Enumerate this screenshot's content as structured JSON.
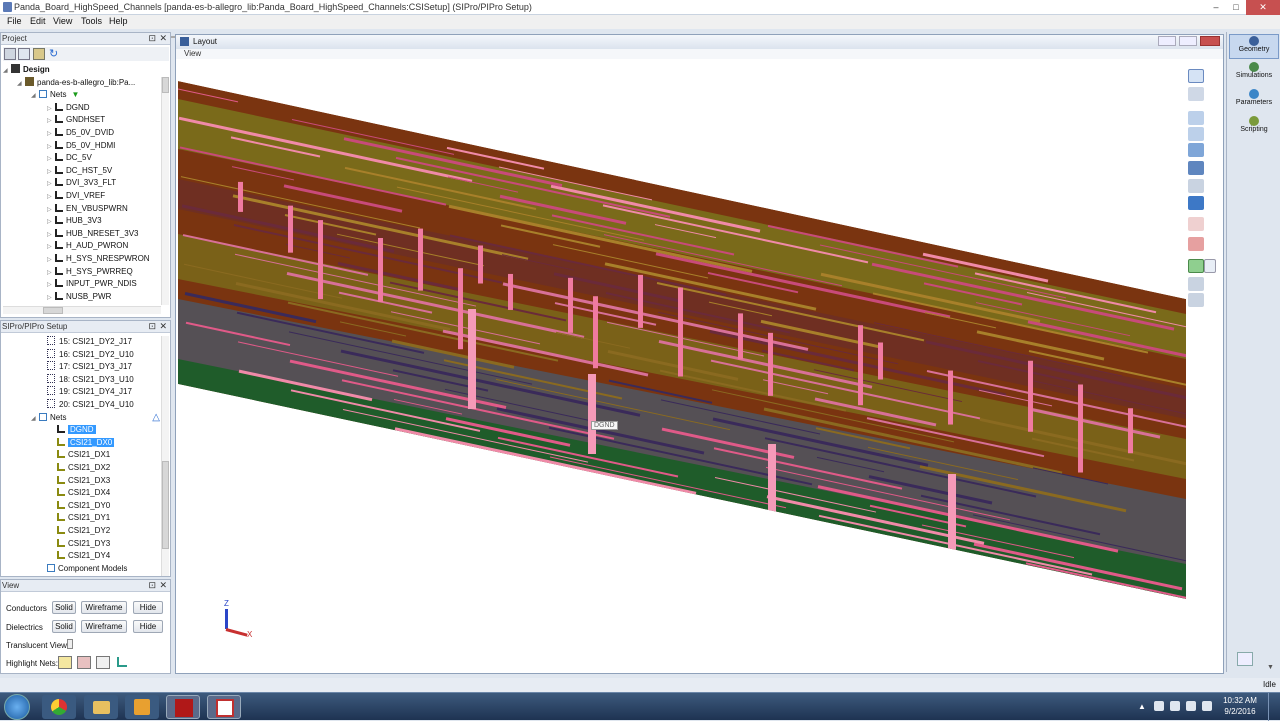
{
  "window": {
    "title": "Panda_Board_HighSpeed_Channels [panda-es-b-allegro_lib:Panda_Board_HighSpeed_Channels:CSISetup] (SIPro/PIPro Setup)"
  },
  "menu": [
    "File",
    "Edit",
    "View",
    "Tools",
    "Help"
  ],
  "zoom_multiplier": "x 1",
  "project_panel": {
    "title": "Project",
    "design_label": "Design",
    "library_label": "panda-es-b-allegro_lib:Pa...",
    "nets_label": "Nets",
    "nets": [
      "DGND",
      "GNDHSET",
      "D5_0V_DVID",
      "D5_0V_HDMI",
      "DC_5V",
      "DC_HST_5V",
      "DVI_3V3_FLT",
      "DVI_VREF",
      "EN_VBUSPWRN",
      "HUB_3V3",
      "HUB_NRESET_3V3",
      "H_AUD_PWRON",
      "H_SYS_NRESPWRON",
      "H_SYS_PWRREQ",
      "INPUT_PWR_NDIS",
      "NUSB_PWR"
    ]
  },
  "setup_panel": {
    "title": "SIPro/PIPro Setup",
    "ports": [
      "15: CSI21_DY2_J17",
      "16: CSI21_DY2_U10",
      "17: CSI21_DY3_J17",
      "18: CSI21_DY3_U10",
      "19: CSI21_DY4_J17",
      "20: CSI21_DY4_U10"
    ],
    "nets_label": "Nets",
    "nets": [
      "DGND",
      "CSI21_DX0",
      "CSI21_DX1",
      "CSI21_DX2",
      "CSI21_DX3",
      "CSI21_DX4",
      "CSI21_DY0",
      "CSI21_DY1",
      "CSI21_DY2",
      "CSI21_DY3",
      "CSI21_DY4"
    ],
    "selected_nets": [
      "DGND",
      "CSI21_DX0"
    ],
    "component_models_label": "Component Models"
  },
  "view_panel": {
    "title": "View",
    "conductors_label": "Conductors",
    "dielectrics_label": "Dielectrics",
    "solid_label": "Solid",
    "wireframe_label": "Wireframe",
    "hide_label": "Hide",
    "translucent_label": "Translucent View:",
    "highlight_label": "Highlight Nets:"
  },
  "layout_window": {
    "title": "Layout",
    "menu_view": "View",
    "tooltip": "DGND",
    "axis_z": "Z",
    "axis_x": "X"
  },
  "right_tabs": [
    {
      "label": "Geometry",
      "icon": "geometry-icon",
      "color": "#3a5f9a",
      "active": true
    },
    {
      "label": "Simulations",
      "icon": "simulations-icon",
      "color": "#4a8a4a",
      "active": false
    },
    {
      "label": "Parameters",
      "icon": "parameters-icon",
      "color": "#3b86c8",
      "active": false
    },
    {
      "label": "Scripting",
      "icon": "scripting-icon",
      "color": "#7a9a3a",
      "active": false
    }
  ],
  "status": {
    "text": "Idle"
  },
  "taskbar": {
    "time": "10:32 AM",
    "date": "9/2/2016",
    "apps": [
      "start-orb-icon",
      "chrome-icon",
      "explorer-icon",
      "outlook-icon",
      "cadence-icon",
      "sipro-icon"
    ]
  },
  "colors": {
    "accent": "#3399ff",
    "board_brown": "#7a3410",
    "board_olive": "#7a6a1a",
    "trace_pink": "#e05a88",
    "ground_green": "#1f5c2a",
    "dielectric_gray": "#555055"
  }
}
